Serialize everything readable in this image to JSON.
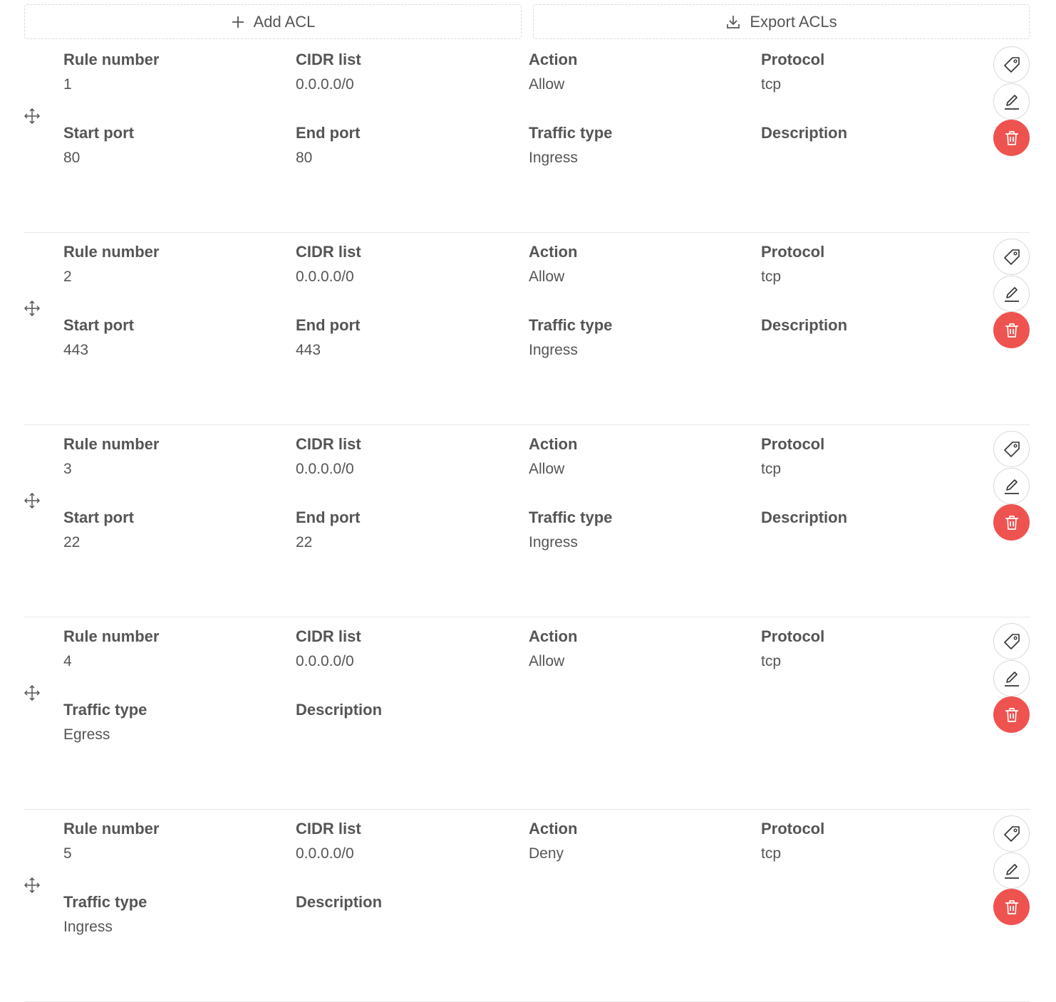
{
  "toolbar": {
    "add_label": "Add ACL",
    "export_label": "Export ACLs"
  },
  "labels": {
    "rule_number": "Rule number",
    "cidr_list": "CIDR list",
    "action": "Action",
    "protocol": "Protocol",
    "start_port": "Start port",
    "end_port": "End port",
    "traffic_type": "Traffic type",
    "description": "Description"
  },
  "rules": [
    {
      "rule_number": "1",
      "cidr_list": "0.0.0.0/0",
      "action": "Allow",
      "protocol": "tcp",
      "start_port": "80",
      "end_port": "80",
      "traffic_type": "Ingress",
      "description": ""
    },
    {
      "rule_number": "2",
      "cidr_list": "0.0.0.0/0",
      "action": "Allow",
      "protocol": "tcp",
      "start_port": "443",
      "end_port": "443",
      "traffic_type": "Ingress",
      "description": ""
    },
    {
      "rule_number": "3",
      "cidr_list": "0.0.0.0/0",
      "action": "Allow",
      "protocol": "tcp",
      "start_port": "22",
      "end_port": "22",
      "traffic_type": "Ingress",
      "description": ""
    },
    {
      "rule_number": "4",
      "cidr_list": "0.0.0.0/0",
      "action": "Allow",
      "protocol": "tcp",
      "traffic_type": "Egress",
      "description": ""
    },
    {
      "rule_number": "5",
      "cidr_list": "0.0.0.0/0",
      "action": "Deny",
      "protocol": "tcp",
      "traffic_type": "Ingress",
      "description": ""
    }
  ],
  "colors": {
    "delete_button": "#ef5350",
    "text": "#555555",
    "border": "#d9d9d9"
  },
  "icons": {
    "add": "plus-icon",
    "export": "download-icon",
    "drag": "drag-handle-icon",
    "tag": "tag-icon",
    "edit": "edit-icon",
    "delete": "trash-icon"
  }
}
